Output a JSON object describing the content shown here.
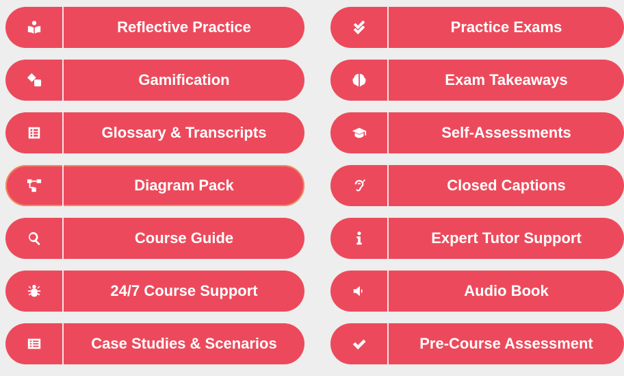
{
  "left": [
    {
      "label": "Reflective Practice",
      "icon": "reader-icon"
    },
    {
      "label": "Gamification",
      "icon": "dice-icon"
    },
    {
      "label": "Glossary & Transcripts",
      "icon": "list-icon"
    },
    {
      "label": "Diagram Pack",
      "icon": "sitemap-icon"
    },
    {
      "label": "Course Guide",
      "icon": "search-icon"
    },
    {
      "label": "24/7 Course Support",
      "icon": "bug-icon"
    },
    {
      "label": "Case Studies & Scenarios",
      "icon": "document-list-icon"
    }
  ],
  "right": [
    {
      "label": "Practice Exams",
      "icon": "double-check-icon"
    },
    {
      "label": "Exam Takeaways",
      "icon": "brain-icon"
    },
    {
      "label": "Self-Assessments",
      "icon": "graduation-cap-icon"
    },
    {
      "label": "Closed Captions",
      "icon": "hearing-icon"
    },
    {
      "label": "Expert Tutor Support",
      "icon": "info-icon"
    },
    {
      "label": "Audio Book",
      "icon": "volume-icon"
    },
    {
      "label": "Pre-Course Assessment",
      "icon": "check-icon"
    }
  ],
  "colors": {
    "pill": "#ec4a5c",
    "background": "#edeeed",
    "highlight_border": "#f08a5d"
  }
}
